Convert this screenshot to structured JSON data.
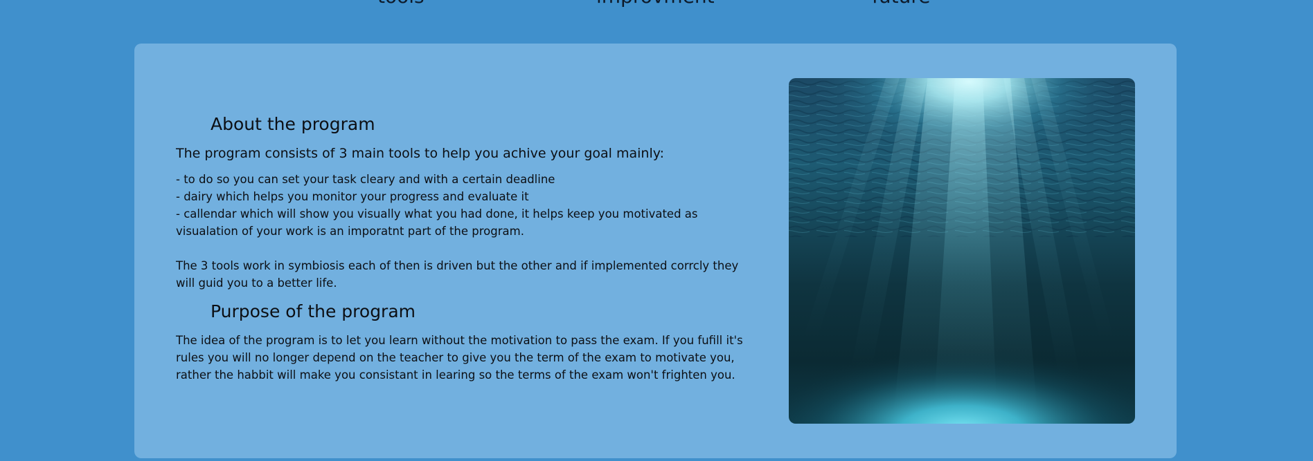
{
  "nav": {
    "items": [
      {
        "label": "tools"
      },
      {
        "label": "improvment"
      },
      {
        "label": "future"
      }
    ]
  },
  "about": {
    "title": "About the program",
    "lead": "The program consists of 3 main tools to help you achive your goal mainly:",
    "tools": [
      "- to do so you can set your task cleary and with a certain deadline",
      "- dairy which helps you monitor your progress and evaluate it",
      "- callendar which will show you visually what you had done, it helps keep you motivated as visualation of your work is an imporatnt part of the program."
    ],
    "symbiosis": "The 3 tools work in symbiosis each of then is driven but the other and if implemented corrcly they will guid you to a better life."
  },
  "purpose": {
    "title": "Purpose of the program",
    "text": "The idea of the program is to let you learn without the motivation to pass the exam. If you fufill it's rules you will no longer depend on the teacher to give you the term of the exam to motivate you, rather the habbit will make you consistant in learing so the terms of the exam won't frighten you."
  },
  "image": {
    "subject": "underwater-ocean-light-rays",
    "colors": {
      "surface": "#bdf3f7",
      "mid": "#1d5a72",
      "deep": "#0b2a33",
      "floor": "#46c7e0"
    }
  }
}
